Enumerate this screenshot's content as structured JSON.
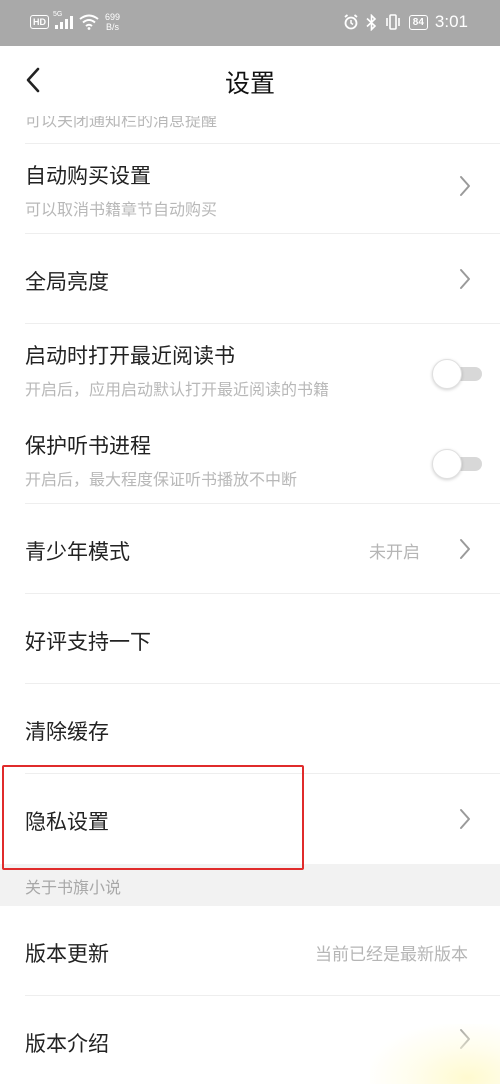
{
  "status_bar": {
    "hd": "HD",
    "network": "5G",
    "speed_value": "699",
    "speed_unit": "B/s",
    "battery": "84",
    "time": "3:01"
  },
  "header": {
    "title": "设置"
  },
  "partial_row": {
    "subtitle": "可以关闭通知栏的消息提醒"
  },
  "rows": {
    "auto_buy": {
      "title": "自动购买设置",
      "subtitle": "可以取消书籍章节自动购买"
    },
    "brightness": {
      "title": "全局亮度"
    },
    "open_recent": {
      "title": "启动时打开最近阅读书",
      "subtitle": "开启后，应用启动默认打开最近阅读的书籍",
      "enabled": false
    },
    "protect_audio": {
      "title": "保护听书进程",
      "subtitle": "开启后，最大程度保证听书播放不中断",
      "enabled": false
    },
    "teen_mode": {
      "title": "青少年模式",
      "value": "未开启"
    },
    "rate": {
      "title": "好评支持一下"
    },
    "clear_cache": {
      "title": "清除缓存"
    },
    "privacy": {
      "title": "隐私设置"
    }
  },
  "about_section": {
    "header": "关于书旗小说",
    "version_update": {
      "title": "版本更新",
      "value": "当前已经是最新版本"
    },
    "version_intro": {
      "title": "版本介绍"
    }
  },
  "colors": {
    "status_bar_bg": "#a9a9a9",
    "highlight_border": "#e02b2b",
    "subtitle_text": "#b8b8b8",
    "section_bg": "#f2f2f2"
  }
}
